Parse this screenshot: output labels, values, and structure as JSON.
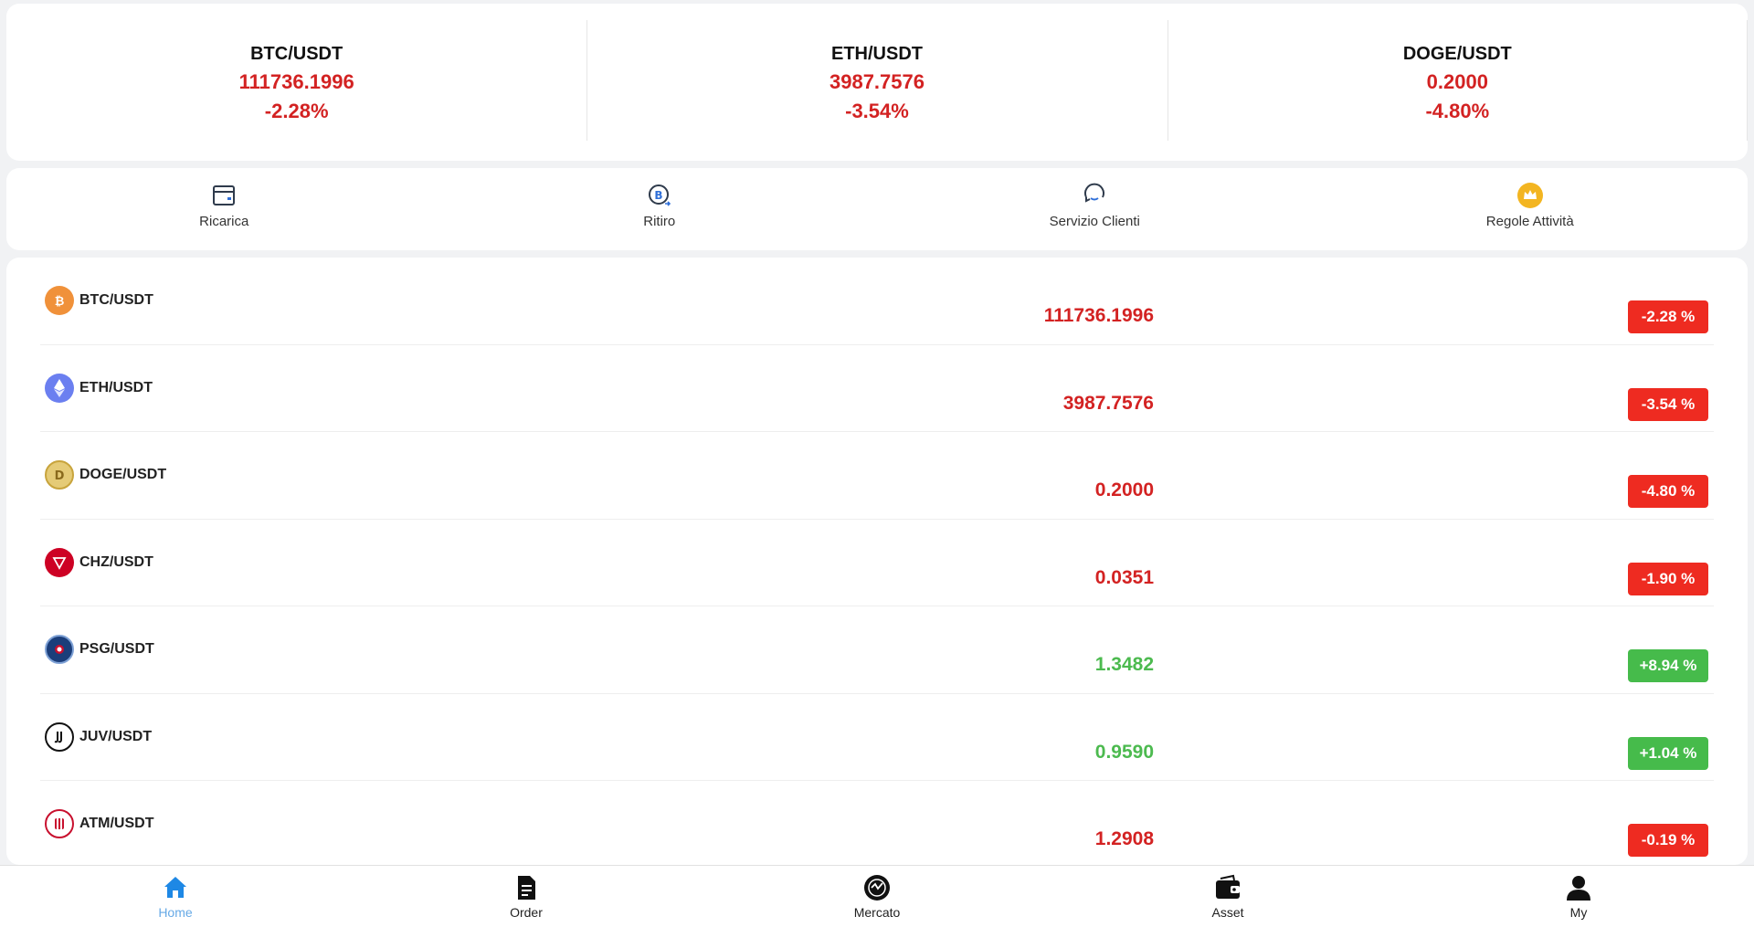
{
  "ticker": [
    {
      "pair": "BTC/USDT",
      "price": "111736.1996",
      "change": "-2.28%"
    },
    {
      "pair": "ETH/USDT",
      "price": "3987.7576",
      "change": "-3.54%"
    },
    {
      "pair": "DOGE/USDT",
      "price": "0.2000",
      "change": "-4.80%"
    }
  ],
  "actions": [
    {
      "label": "Ricarica",
      "icon": "wallet-card-icon"
    },
    {
      "label": "Ritiro",
      "icon": "bitcoin-withdraw-icon"
    },
    {
      "label": "Servizio Clienti",
      "icon": "customer-service-icon"
    },
    {
      "label": "Regole Attività",
      "icon": "crown-icon"
    }
  ],
  "market": [
    {
      "pair": "BTC/USDT",
      "price": "111736.1996",
      "change": "-2.28 %",
      "trend": "neg",
      "icon": "bitcoin-icon",
      "color": "#f0913a"
    },
    {
      "pair": "ETH/USDT",
      "price": "3987.7576",
      "change": "-3.54 %",
      "trend": "neg",
      "icon": "ethereum-icon",
      "color": "#6b7ff0"
    },
    {
      "pair": "DOGE/USDT",
      "price": "0.2000",
      "change": "-4.80 %",
      "trend": "neg",
      "icon": "dogecoin-icon",
      "color": "#c8a43c"
    },
    {
      "pair": "CHZ/USDT",
      "price": "0.0351",
      "change": "-1.90 %",
      "trend": "neg",
      "icon": "chiliz-icon",
      "color": "#cd0124"
    },
    {
      "pair": "PSG/USDT",
      "price": "1.3482",
      "change": "+8.94 %",
      "trend": "pos",
      "icon": "psg-icon",
      "color": "#1b3e7a"
    },
    {
      "pair": "JUV/USDT",
      "price": "0.9590",
      "change": "+1.04 %",
      "trend": "pos",
      "icon": "juventus-icon",
      "color": "#111111"
    },
    {
      "pair": "ATM/USDT",
      "price": "1.2908",
      "change": "-0.19 %",
      "trend": "neg",
      "icon": "atletico-icon",
      "color": "#c8102e"
    }
  ],
  "nav": [
    {
      "label": "Home",
      "icon": "home-icon",
      "active": true
    },
    {
      "label": "Order",
      "icon": "order-document-icon",
      "active": false
    },
    {
      "label": "Mercato",
      "icon": "market-icon",
      "active": false
    },
    {
      "label": "Asset",
      "icon": "wallet-icon",
      "active": false
    },
    {
      "label": "My",
      "icon": "user-icon",
      "active": false
    }
  ],
  "colors": {
    "negative": "#ee2b21",
    "positive": "#46bb4b",
    "accent": "#1e88e5"
  }
}
